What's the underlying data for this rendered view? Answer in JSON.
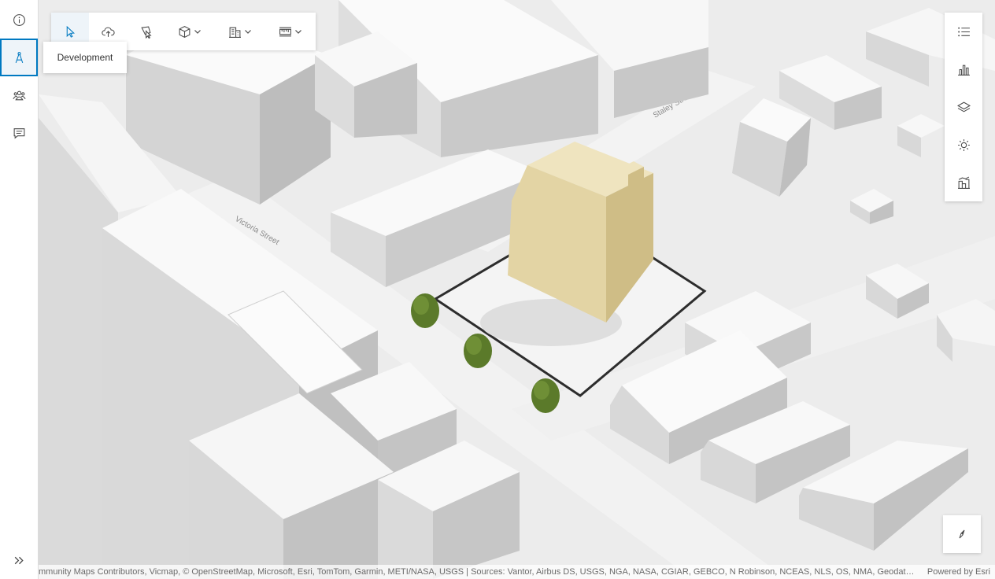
{
  "rail": {
    "items": [
      {
        "name": "info",
        "icon": "info-icon"
      },
      {
        "name": "development",
        "icon": "compass-drafting-icon",
        "active": true
      },
      {
        "name": "community",
        "icon": "people-icon"
      },
      {
        "name": "feedback",
        "icon": "comment-icon"
      }
    ],
    "expand_icon": "double-chevron-right-icon"
  },
  "toolbar": {
    "tools": [
      {
        "name": "select",
        "icon": "cursor-arrow-icon",
        "active": true
      },
      {
        "name": "upload",
        "icon": "cloud-upload-icon"
      },
      {
        "name": "draw-shape",
        "icon": "shape-cursor-icon"
      },
      {
        "name": "create-volume",
        "icon": "cube-icon",
        "dropdown": true
      },
      {
        "name": "building-tools",
        "icon": "building-icon",
        "dropdown": true
      },
      {
        "name": "measure",
        "icon": "ruler-icon",
        "dropdown": true
      }
    ]
  },
  "tooltip": {
    "text": "Development"
  },
  "right_panel": {
    "items": [
      {
        "name": "legend",
        "icon": "list-icon"
      },
      {
        "name": "charts",
        "icon": "bar-chart-icon"
      },
      {
        "name": "layers",
        "icon": "layers-icon"
      },
      {
        "name": "daylight",
        "icon": "sun-icon"
      },
      {
        "name": "scenario",
        "icon": "city-chart-icon"
      }
    ]
  },
  "compass": {
    "icon": "compass-needle-icon"
  },
  "map": {
    "streets": {
      "staley": "Staley Street",
      "victoria": "Victoria Street"
    },
    "selected_building_color": "#e3d4a4",
    "tree_color": "#5b7a2a",
    "background_color": "#e9e9e9"
  },
  "attribution": {
    "text": "mmunity Maps Contributors, Vicmap, © OpenStreetMap, Microsoft, Esri, TomTom, Garmin, METI/NASA, USGS | Sources: Vantor, Airbus DS, USGS, NGA, NASA, CGIAR, GEBCO, N Robinson, NCEAS, NLS, OS, NMA, Geodatastyrelsen, Rijkswaterstaat, GSA, Geoland, FEMA, Intermap",
    "powered": "Powered by Esri"
  }
}
